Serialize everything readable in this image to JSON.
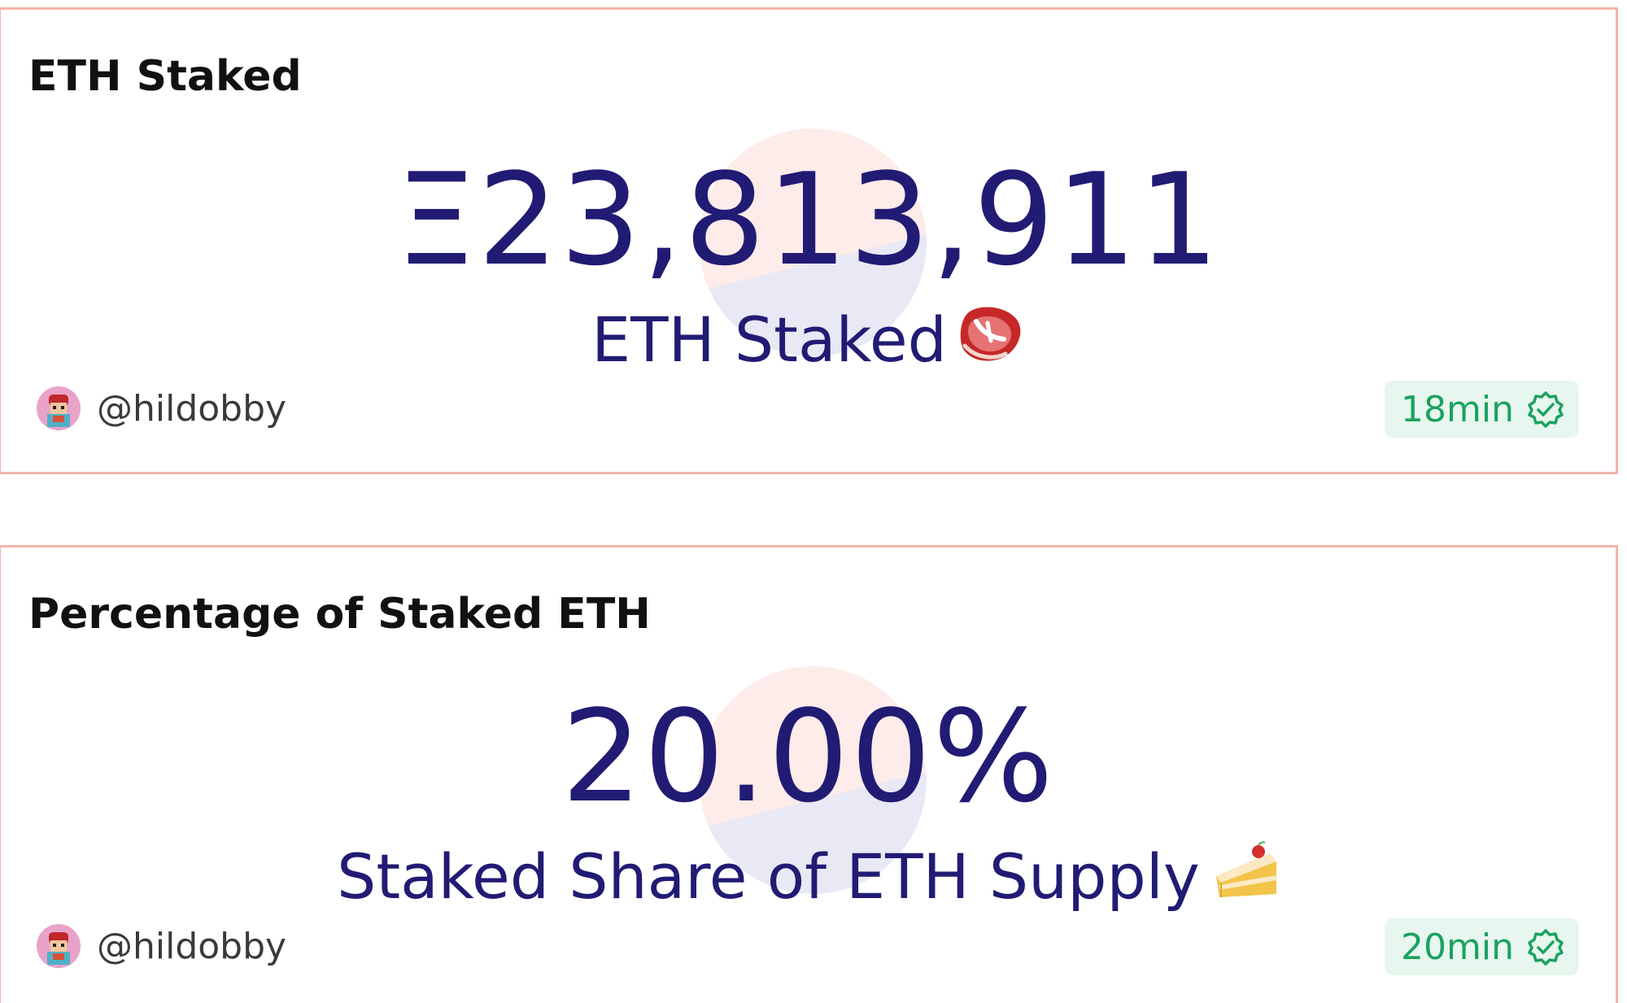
{
  "cards": [
    {
      "title": "ETH Staked",
      "value": "Ξ23,813,911",
      "subtitle": "ETH Staked",
      "emoji_icon": "steak-icon",
      "author": "@hildobby",
      "freshness": "18min",
      "freshness_icon": "verified-check-icon"
    },
    {
      "title": "Percentage of Staked ETH",
      "value": "20.00%",
      "subtitle": "Staked Share of ETH Supply",
      "emoji_icon": "cake-icon",
      "author": "@hildobby",
      "freshness": "20min",
      "freshness_icon": "verified-check-icon"
    }
  ],
  "colors": {
    "card_border": "#f4b4ab",
    "value_text": "#221b74",
    "freshness_bg": "#e7f6ee",
    "freshness_text": "#1aa260"
  }
}
